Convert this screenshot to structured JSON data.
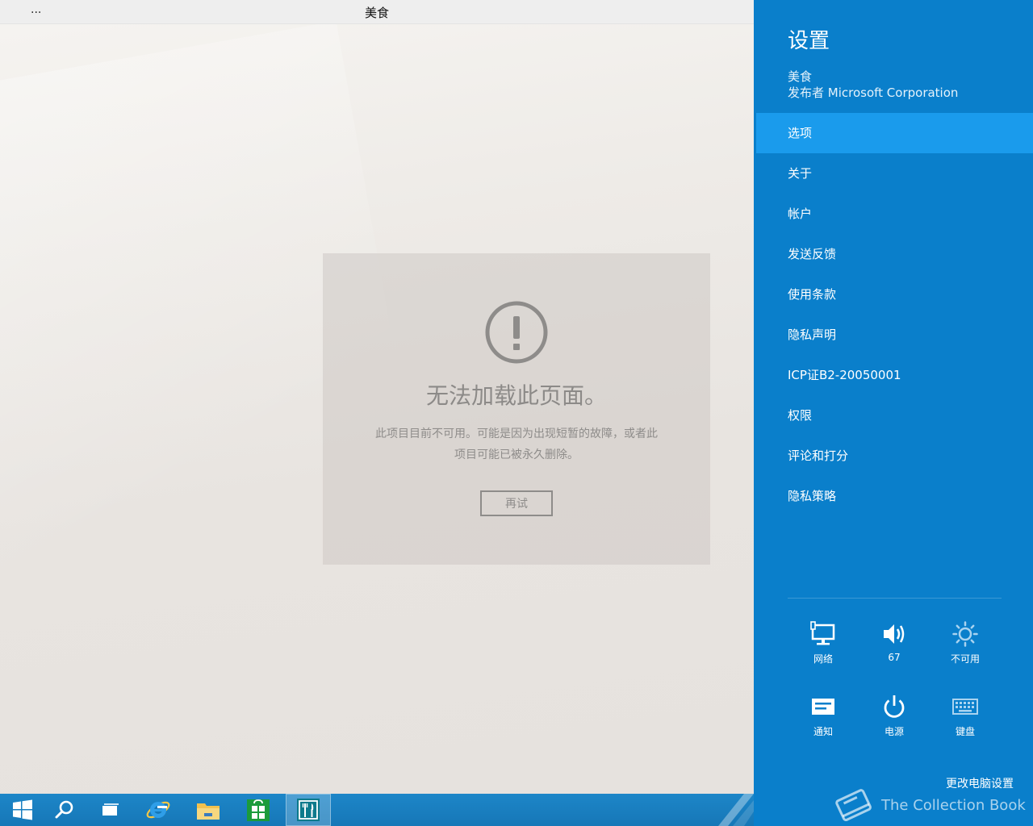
{
  "window": {
    "title": "美食",
    "menu_glyph": "..."
  },
  "error": {
    "title": "无法加载此页面。",
    "message": "此项目目前不可用。可能是因为出现短暂的故障，或者此项目可能已被永久删除。",
    "retry_label": "再试"
  },
  "settings": {
    "title": "设置",
    "app_name": "美食",
    "publisher": "发布者 Microsoft Corporation",
    "menu": [
      {
        "label": "选项",
        "selected": true
      },
      {
        "label": "关于"
      },
      {
        "label": "帐户"
      },
      {
        "label": "发送反馈"
      },
      {
        "label": "使用条款"
      },
      {
        "label": "隐私声明"
      },
      {
        "label": "ICP证B2-20050001"
      },
      {
        "label": "权限"
      },
      {
        "label": "评论和打分"
      },
      {
        "label": "隐私策略"
      }
    ],
    "quick": {
      "network_label": "网络",
      "volume_label": "67",
      "brightness_label": "不可用",
      "notifications_label": "通知",
      "power_label": "电源",
      "keyboard_label": "键盘"
    },
    "change_pc_settings": "更改电脑设置"
  },
  "watermark": {
    "text": "The Collection Book"
  },
  "taskbar": {
    "items": [
      {
        "icon": "windows-start-icon"
      },
      {
        "icon": "search-icon"
      },
      {
        "icon": "task-view-icon"
      },
      {
        "icon": "internet-explorer-icon"
      },
      {
        "icon": "file-explorer-icon"
      },
      {
        "icon": "store-icon"
      },
      {
        "icon": "food-app-icon",
        "active": true
      }
    ]
  },
  "colors": {
    "accent": "#0a7fcb",
    "selected": "#1a9bec",
    "taskbar": "#1a7fc1"
  }
}
